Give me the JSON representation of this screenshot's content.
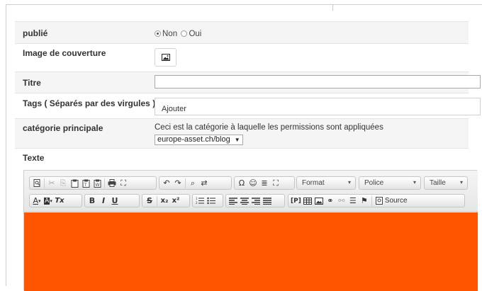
{
  "form": {
    "published": {
      "label": "publié",
      "options": [
        "Non",
        "Oui"
      ],
      "selected": "Non"
    },
    "cover": {
      "label": "Image de couverture",
      "button_icon": "image-icon"
    },
    "title": {
      "label": "Titre",
      "value": ""
    },
    "tags": {
      "label": "Tags ( Séparés par des virgules )",
      "add_text": "Ajouter"
    },
    "category": {
      "label": "catégorie principale",
      "help": "Ceci est la catégorie à laquelle les permissions sont appliquées",
      "selected": "europe-asset.ch/blog",
      "arrow": "▼"
    },
    "text": {
      "label": "Texte"
    }
  },
  "editor": {
    "row1": {
      "clipboard": [
        "preview-icon",
        "cut-icon",
        "copy-icon",
        "paste-icon",
        "paste-text-icon",
        "paste-word-icon",
        "print-icon",
        "maximize-icon"
      ],
      "undo": [
        "↶",
        "↷",
        "⌕",
        "⇄"
      ],
      "insert": [
        "Ω",
        "☺",
        "≣",
        "⛶"
      ],
      "combos": [
        {
          "label": "Format",
          "arrow": "▾"
        },
        {
          "label": "Police",
          "arrow": "▾"
        },
        {
          "label": "Taille",
          "arrow": "▾"
        }
      ]
    },
    "row2": {
      "text_color": "A",
      "bg_color": "A",
      "remove_format": "Tx",
      "bold": "B",
      "italic": "I",
      "underline": "U",
      "strike": "S",
      "subscript": "x₂",
      "superscript": "x²",
      "source_label": "Source"
    },
    "content_color": "#ff5500"
  }
}
